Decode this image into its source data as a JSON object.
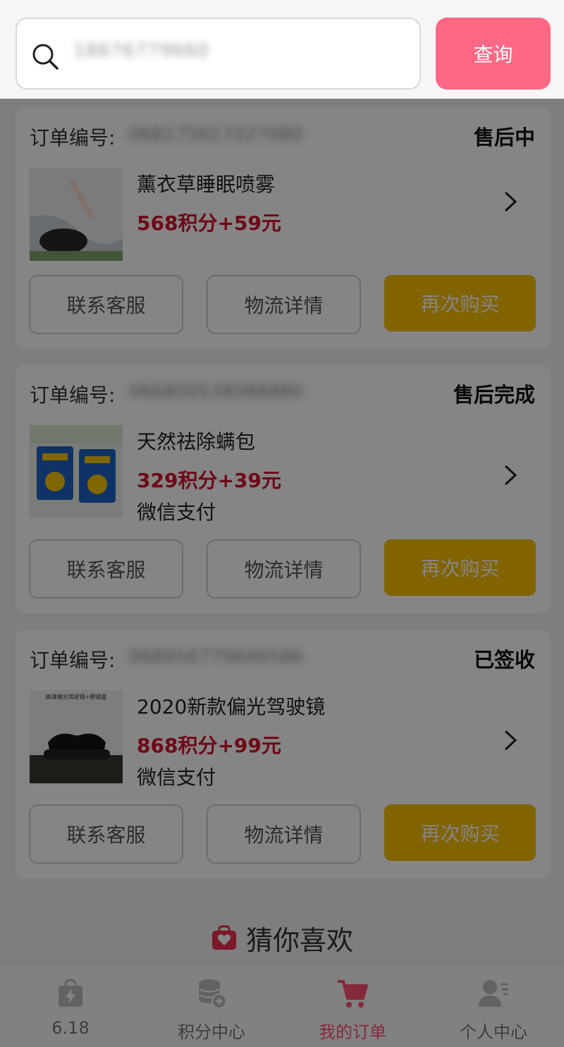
{
  "search": {
    "value": "18676779660",
    "button_label": "查询"
  },
  "orders": [
    {
      "label": "订单编号:",
      "number": "068175617227080",
      "status": "售后中",
      "product_name": "薰衣草睡眠喷雾",
      "price": "568积分+59元",
      "pay_method": "",
      "buttons": {
        "service": "联系客服",
        "logistics": "物流详情",
        "rebuy": "再次购买"
      }
    },
    {
      "label": "订单编号:",
      "number": "066800538088880",
      "status": "售后完成",
      "product_name": "天然祛除螨包",
      "price": "329积分+39元",
      "pay_method": "微信支付",
      "buttons": {
        "service": "联系客服",
        "logistics": "物流详情",
        "rebuy": "再次购买"
      }
    },
    {
      "label": "订单编号:",
      "number": "068956779646586",
      "status": "已签收",
      "product_name": "2020新款偏光驾驶镜",
      "price": "868积分+99元",
      "pay_method": "微信支付",
      "buttons": {
        "service": "联系客服",
        "logistics": "物流详情",
        "rebuy": "再次购买"
      }
    }
  ],
  "guess": {
    "title": "猜你喜欢",
    "icon": "heart-bag-icon"
  },
  "tabbar": [
    {
      "label": "6.18",
      "icon": "lightning-bag-icon"
    },
    {
      "label": "积分中心",
      "icon": "coin-stack-icon"
    },
    {
      "label": "我的订单",
      "icon": "cart-icon",
      "active": true
    },
    {
      "label": "个人中心",
      "icon": "user-card-icon"
    }
  ],
  "product_thumbs": [
    {
      "caption": "",
      "icon": "spray-bottle-photo"
    },
    {
      "caption": "",
      "icon": "mite-pack-photo"
    },
    {
      "caption": "高清偏光驾驶镜+眼镜盒",
      "icon": "sunglasses-photo"
    }
  ],
  "colors": {
    "accent_pink": "#fe6885",
    "price_red": "#d4112d",
    "rebuy_yellow": "#f7bf00"
  }
}
